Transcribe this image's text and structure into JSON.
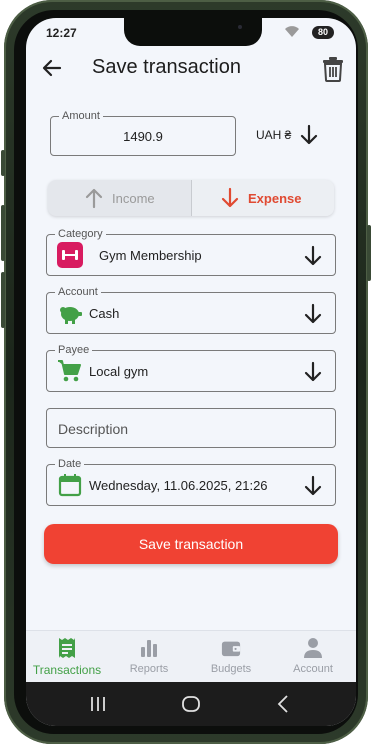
{
  "status_bar": {
    "time": "12:27",
    "battery": "80"
  },
  "header": {
    "title": "Save transaction"
  },
  "amount": {
    "label": "Amount",
    "value": "1490.9",
    "currency": "UAH ₴"
  },
  "type_toggle": {
    "income": "Income",
    "expense": "Expense",
    "selected": "Expense"
  },
  "category": {
    "label": "Category",
    "value": "Gym Membership"
  },
  "account": {
    "label": "Account",
    "value": "Cash"
  },
  "payee": {
    "label": "Payee",
    "value": "Local gym"
  },
  "description": {
    "placeholder": "Description"
  },
  "date": {
    "label": "Date",
    "value": "Wednesday, 11.06.2025, 21:26"
  },
  "save_button": "Save transaction",
  "nav": [
    {
      "label": "Transactions",
      "icon": "receipt-icon",
      "active": true
    },
    {
      "label": "Reports",
      "icon": "bar-chart-icon"
    },
    {
      "label": "Budgets",
      "icon": "wallet-icon"
    },
    {
      "label": "Account",
      "icon": "person-icon"
    }
  ],
  "colors": {
    "accent_red": "#f04233",
    "active_green": "#43a047",
    "category_icon_bg": "#d81b60"
  }
}
